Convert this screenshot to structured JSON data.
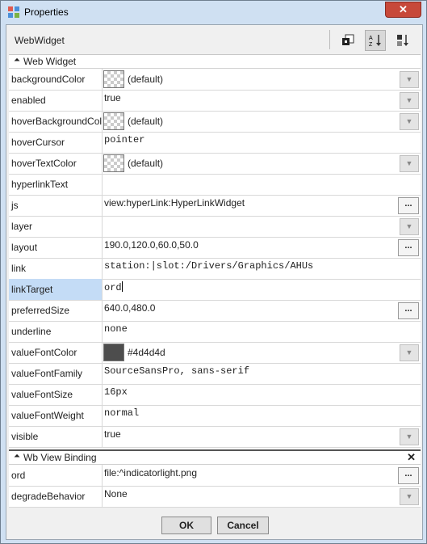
{
  "window": {
    "title": "Properties",
    "close_glyph": "✕"
  },
  "toolbar": {
    "label": "WebWidget"
  },
  "groups": [
    {
      "label": "Web Widget"
    },
    {
      "label": "Wb View Binding"
    }
  ],
  "properties": [
    {
      "name": "backgroundColor",
      "value": "(default)"
    },
    {
      "name": "enabled",
      "value": "true"
    },
    {
      "name": "hoverBackgroundColor",
      "value": "(default)"
    },
    {
      "name": "hoverCursor",
      "value": "pointer"
    },
    {
      "name": "hoverTextColor",
      "value": "(default)"
    },
    {
      "name": "hyperlinkText",
      "value": ""
    },
    {
      "name": "js",
      "value": "view:hyperLink:HyperLinkWidget"
    },
    {
      "name": "layer",
      "value": ""
    },
    {
      "name": "layout",
      "value": "190.0,120.0,60.0,50.0"
    },
    {
      "name": "link",
      "value": "station:|slot:/Drivers/Graphics/AHUs"
    },
    {
      "name": "linkTarget",
      "value": "ord"
    },
    {
      "name": "preferredSize",
      "value": "640.0,480.0"
    },
    {
      "name": "underline",
      "value": "none"
    },
    {
      "name": "valueFontColor",
      "value": "#4d4d4d",
      "swatch_color": "#4d4d4d"
    },
    {
      "name": "valueFontFamily",
      "value": "SourceSansPro, sans-serif"
    },
    {
      "name": "valueFontSize",
      "value": "16px"
    },
    {
      "name": "valueFontWeight",
      "value": "normal"
    },
    {
      "name": "visible",
      "value": "true"
    }
  ],
  "binding_properties": [
    {
      "name": "ord",
      "value": "file:^indicatorlight.png"
    },
    {
      "name": "degradeBehavior",
      "value": "None"
    }
  ],
  "buttons": {
    "ok": "OK",
    "cancel": "Cancel"
  },
  "ellipsis": "...",
  "dropdown_glyph": "▼",
  "collapse_glyph": "⏶",
  "colors": {
    "selected_row": "#c4dcf6",
    "title_bar": "#cfe0f2",
    "close_button": "#c7493a"
  },
  "icons": [
    "properties-icon",
    "add-slot-icon",
    "sort-az-icon",
    "sort-order-icon",
    "collapse-icon",
    "close-icon",
    "dropdown-icon",
    "ellipsis-icon"
  ]
}
